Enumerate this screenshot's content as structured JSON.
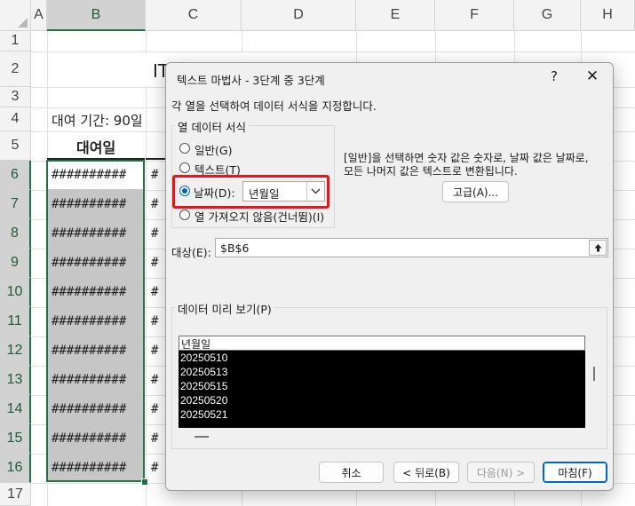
{
  "sheet": {
    "columns": [
      "A",
      "B",
      "C",
      "D",
      "E",
      "F",
      "G",
      "H"
    ],
    "rows": [
      "1",
      "2",
      "3",
      "4",
      "5",
      "6",
      "7",
      "8",
      "9",
      "10",
      "11",
      "12",
      "13",
      "14",
      "15",
      "16",
      "17"
    ],
    "title_partial": "IT 장비 대여 내역",
    "period_label": "대여 기간: 90일",
    "header_rental_date": "대여일",
    "hash_cell": "##########",
    "hash_cell_c": "#"
  },
  "dialog": {
    "title": "텍스트 마법사 - 3단계 중 3단계",
    "help_label": "?",
    "close_label": "✕",
    "intro": "각 열을 선택하여 데이터 서식을 지정합니다.",
    "column_format_group": "열 데이터 서식",
    "options": {
      "general": "일반(G)",
      "text": "텍스트(T)",
      "date": "날짜(D):",
      "skip": "열 가져오지 않음(건너뜀)(I)"
    },
    "selected_option": "date",
    "date_format": "년월일",
    "hint_line1": "[일반]을 선택하면 숫자 값은 숫자로, 날짜 값은 날짜로,",
    "hint_line2": "모든 나머지 값은 텍스트로 변환됩니다.",
    "advanced_button": "고급(A)...",
    "target_label": "대상(E):",
    "target_value": "$B$6",
    "preview_title": "데이터 미리 보기(P)",
    "preview_header": "년월일",
    "preview_rows": [
      "20250510",
      "20250513",
      "20250515",
      "20250520",
      "20250521"
    ],
    "buttons": {
      "cancel": "취소",
      "back": "< 뒤로(B)",
      "next": "다음(N) >",
      "finish": "마침(F)"
    }
  },
  "colors": {
    "excel_green": "#217346",
    "highlight_red": "#e8141b",
    "accent_blue": "#0067c0"
  }
}
